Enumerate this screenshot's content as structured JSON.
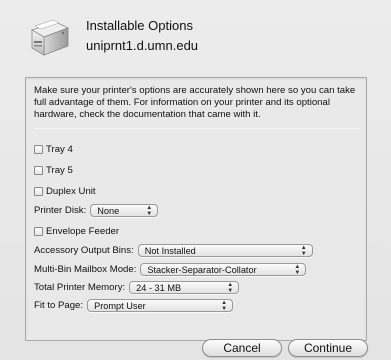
{
  "header": {
    "title": "Installable Options",
    "subtitle": "uniprnt1.d.umn.edu"
  },
  "description": "Make sure your printer's options are accurately shown here so you can take full advantage of them.  For information on your printer and its optional hardware, check the documentation that came with it.",
  "options": {
    "tray4": {
      "label": "Tray 4",
      "checked": false
    },
    "tray5": {
      "label": "Tray 5",
      "checked": false
    },
    "duplex": {
      "label": "Duplex Unit",
      "checked": false
    },
    "printer_disk": {
      "label": "Printer Disk:",
      "value": "None"
    },
    "envelope": {
      "label": "Envelope Feeder",
      "checked": false
    },
    "output_bins": {
      "label": "Accessory Output Bins:",
      "value": "Not Installed"
    },
    "mailbox_mode": {
      "label": "Multi-Bin Mailbox Mode:",
      "value": "Stacker-Separator-Collator"
    },
    "memory": {
      "label": "Total Printer Memory:",
      "value": "24 - 31 MB"
    },
    "fit_to_page": {
      "label": "Fit to Page:",
      "value": "Prompt User"
    }
  },
  "buttons": {
    "cancel": "Cancel",
    "continue": "Continue"
  }
}
